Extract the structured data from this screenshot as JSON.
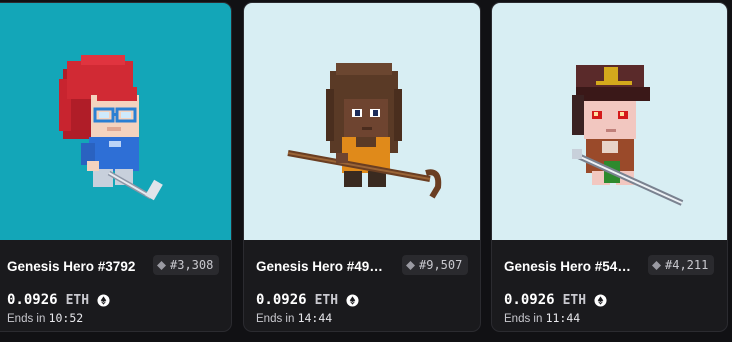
{
  "cards": [
    {
      "name": "Genesis Hero #3792",
      "rank": "#3,308",
      "price": "0.0926",
      "currency": "ETH",
      "ends_label": "Ends in",
      "ends_time": "10:52",
      "background": "#13a6b8",
      "icon": "golf-club-hero-avatar"
    },
    {
      "name": "Genesis Hero #49…",
      "rank": "#9,507",
      "price": "0.0926",
      "currency": "ETH",
      "ends_label": "Ends in",
      "ends_time": "14:44",
      "background": "#d8eef3",
      "icon": "staff-hero-avatar"
    },
    {
      "name": "Genesis Hero #54…",
      "rank": "#4,211",
      "price": "0.0926",
      "currency": "ETH",
      "ends_label": "Ends in",
      "ends_time": "11:44",
      "background": "#d8eef3",
      "icon": "sword-hero-avatar"
    }
  ],
  "colors": {
    "page_bg": "#111114",
    "card_bg": "#1a1a1d",
    "badge_bg": "#2a2a2e",
    "muted_text": "#c9c9cf"
  }
}
